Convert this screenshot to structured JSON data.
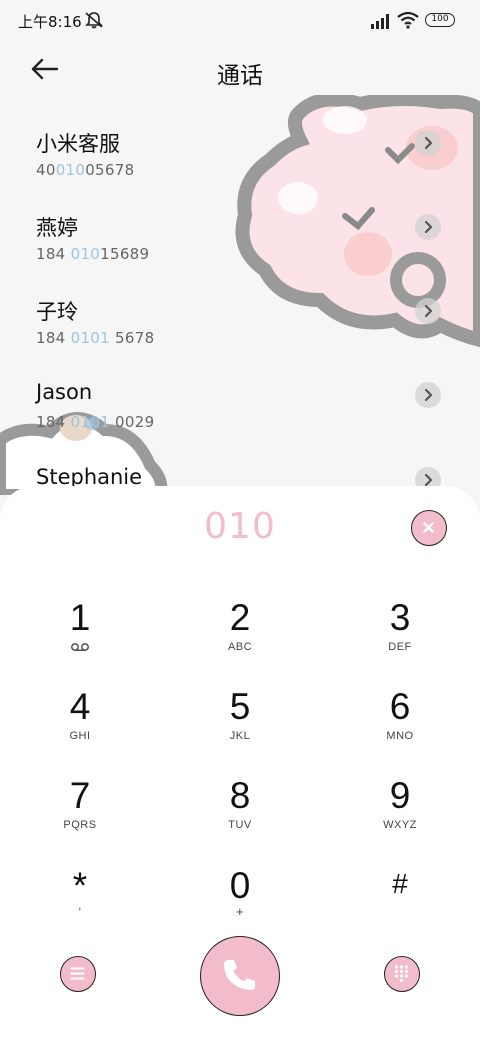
{
  "status_bar": {
    "time": "上午8:16",
    "battery": "100",
    "icons": [
      "mute-bell-icon",
      "signal-icon",
      "wifi-icon",
      "battery-icon"
    ]
  },
  "header": {
    "title": "通话",
    "back_icon": "arrow-left-icon"
  },
  "contacts": [
    {
      "name": "小米客服",
      "number_pre": "40",
      "number_hl": "010",
      "number_post": "05678"
    },
    {
      "name": "燕婷",
      "number_pre": "184 ",
      "number_hl": "010",
      "number_post": "15689"
    },
    {
      "name": "子玲",
      "number_pre": "184 ",
      "number_hl": "0101",
      "number_post": " 5678"
    },
    {
      "name": "Jason",
      "number_pre": "184 ",
      "number_hl": "0101",
      "number_post": " 0029"
    },
    {
      "name": "Stephanie",
      "number_pre": "",
      "number_hl": "",
      "number_post": ""
    }
  ],
  "dialer": {
    "input_value": "010",
    "keys": [
      {
        "digit": "1",
        "letters": ""
      },
      {
        "digit": "2",
        "letters": "ABC"
      },
      {
        "digit": "3",
        "letters": "DEF"
      },
      {
        "digit": "4",
        "letters": "GHI"
      },
      {
        "digit": "5",
        "letters": "JKL"
      },
      {
        "digit": "6",
        "letters": "MNO"
      },
      {
        "digit": "7",
        "letters": "PQRS"
      },
      {
        "digit": "8",
        "letters": "TUV"
      },
      {
        "digit": "9",
        "letters": "WXYZ"
      },
      {
        "digit": "*",
        "letters": ","
      },
      {
        "digit": "0",
        "letters": "+"
      },
      {
        "digit": "#",
        "letters": ""
      }
    ]
  },
  "colors": {
    "accent_pink": "#f2bccb",
    "highlight_blue": "#9cc6e0",
    "sheet_bg": "#ffffff",
    "page_bg": "#f6f6f6"
  }
}
